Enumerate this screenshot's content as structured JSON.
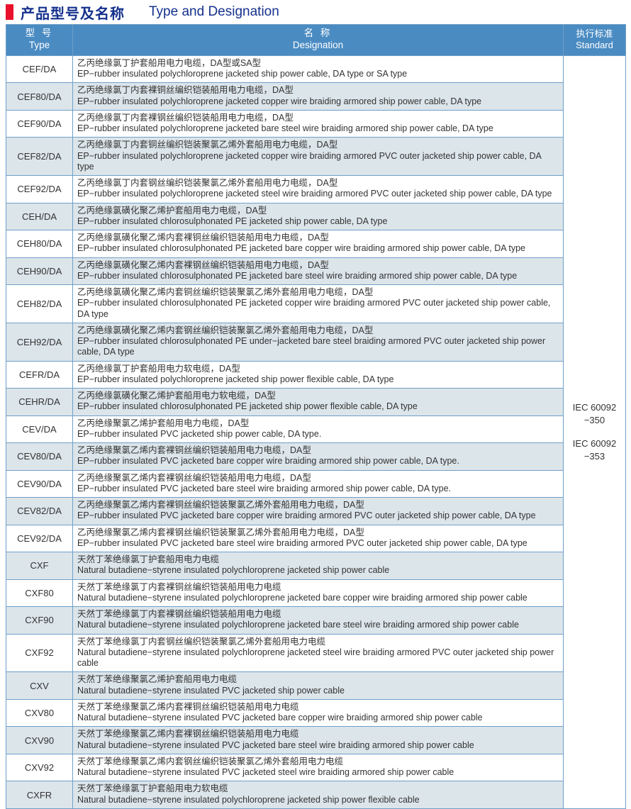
{
  "title": {
    "marker_color": "#e8102a",
    "cn": "产品型号及名称",
    "en": "Type and Designation"
  },
  "colors": {
    "header_blue": "#4a8bc2",
    "border_blue": "#6f9fc8",
    "row_shade": "#dce5ea",
    "title_navy": "#14308c",
    "marker_red": "#e8102a"
  },
  "table": {
    "columns": [
      {
        "cn": "型  号",
        "en": "Type"
      },
      {
        "cn": "名  称",
        "en": "Designation"
      },
      {
        "cn": "执行标准",
        "en": "Standard"
      }
    ],
    "standard": {
      "line1": "IEC 60092",
      "line2": "−350",
      "line3": "IEC 60092",
      "line4": "−353"
    },
    "rows": [
      {
        "type": "CEF/DA",
        "cn": "乙丙绝缘氯丁护套船用电力电缆，DA型或SA型",
        "en": "EP−rubber insulated polychloroprene jacketed ship power cable, DA type or SA type"
      },
      {
        "type": "CEF80/DA",
        "cn": "乙丙绝缘氯丁内套裸铜丝编织铠装船用电力电缆，DA型",
        "en": "EP−rubber insulated polychloroprene jacketed copper wire braiding armored ship power cable, DA type"
      },
      {
        "type": "CEF90/DA",
        "cn": "乙丙绝缘氯丁内套裸钢丝编织铠装船用电力电缆，DA型",
        "en": "EP−rubber insulated polychloroprene jacketed bare steel wire braiding armored ship power cable, DA type"
      },
      {
        "type": "CEF82/DA",
        "cn": "乙丙绝缘氯丁内套铜丝编织铠装聚氯乙烯外套船用电力电缆，DA型",
        "en": "EP−rubber insulated polychloroprene jacketed copper wire braiding armored PVC outer jacketed ship power cable, DA type"
      },
      {
        "type": "CEF92/DA",
        "cn": "乙丙绝缘氯丁内套钢丝编织铠装聚氯乙烯外套船用电力电缆，DA型",
        "en": "EP−rubber insulated polychloroprene jacketed steel wire braiding armored PVC outer jacketed ship power cable, DA type"
      },
      {
        "type": "CEH/DA",
        "cn": "乙丙绝缘氯磺化聚乙烯护套船用电力电缆，DA型",
        "en": "EP−rubber insulated chlorosulphonated PE jacketed ship power cable, DA type"
      },
      {
        "type": "CEH80/DA",
        "cn": "乙丙绝缘氯磺化聚乙烯内套裸铜丝编织铠装船用电力电缆，DA型",
        "en": "EP−rubber insulated chlorosulphonated PE jacketed bare copper wire braiding armored ship power cable, DA type"
      },
      {
        "type": "CEH90/DA",
        "cn": "乙丙绝缘氯磺化聚乙烯内套裸钢丝编织铠装船用电力电缆，DA型",
        "en": "EP−rubber insulated chlorosulphonated PE jacketed bare steel wire braiding armored ship power cable, DA type"
      },
      {
        "type": "CEH82/DA",
        "cn": "乙丙绝缘氯磺化聚乙烯内套铜丝编织铠装聚氯乙烯外套船用电力电缆，DA型",
        "en": "EP−rubber insulated chlorosulphonated PE jacketed copper wire braiding armored PVC outer jacketed ship power cable, DA type"
      },
      {
        "type": "CEH92/DA",
        "cn": "乙丙绝缘氯磺化聚乙烯内套钢丝编织铠装聚氯乙烯外套船用电力电缆，DA型",
        "en": "EP−rubber insulated chlorosulphonated PE under−jacketed bare steel braiding armored PVC outer jacketed ship power cable, DA type"
      },
      {
        "type": "CEFR/DA",
        "cn": "乙丙绝缘氯丁护套船用电力软电缆，DA型",
        "en": "EP−rubber insulated polychloroprene jacketed ship power flexible cable, DA type"
      },
      {
        "type": "CEHR/DA",
        "cn": "乙丙绝缘氯磺化聚乙烯护套船用电力软电缆，DA型",
        "en": "EP−rubber insulated chlorosulphonated PE jacketed ship power flexible cable, DA type"
      },
      {
        "type": "CEV/DA",
        "cn": "乙丙绝缘聚氯乙烯护套船用电力电缆，DA型",
        "en": "EP−rubber insulated PVC jacketed ship power cable, DA type."
      },
      {
        "type": "CEV80/DA",
        "cn": "乙丙绝缘聚氯乙烯内套裸铜丝编织铠装船用电力电缆，DA型",
        "en": "EP−rubber insulated PVC jacketed bare copper wire braiding armored ship power cable, DA type."
      },
      {
        "type": "CEV90/DA",
        "cn": "乙丙绝缘聚氯乙烯内套裸钢丝编织铠装船用电力电缆，DA型",
        "en": "EP−rubber insulated PVC jacketed bare steel wire braiding armored ship power cable, DA type."
      },
      {
        "type": "CEV82/DA",
        "cn": "乙丙绝缘聚氯乙烯内套裸铜丝编织铠装聚氯乙烯外套船用电力电缆，DA型",
        "en": "EP−rubber insulated PVC jacketed bare copper wire braiding armored PVC outer jacketed ship power cable, DA type"
      },
      {
        "type": "CEV92/DA",
        "cn": "乙丙绝缘聚氯乙烯内套裸钢丝编织铠装聚氯乙烯外套船用电力电缆，DA型",
        "en": "EP−rubber insulated PVC jacketed bare steel wire braiding armored PVC outer jacketed ship power cable, DA type"
      },
      {
        "type": "CXF",
        "cn": "天然丁苯绝缘氯丁护套船用电力电缆",
        "en": "Natural butadiene−styrene insulated polychloroprene jacketed ship power cable"
      },
      {
        "type": "CXF80",
        "cn": "天然丁苯绝缘氯丁内套裸铜丝编织铠装船用电力电缆",
        "en": "Natural butadiene−styrene insulated polychloroprene jacketed bare copper wire braiding armored ship power cable"
      },
      {
        "type": "CXF90",
        "cn": "天然丁苯绝缘氯丁内套裸钢丝编织铠装船用电力电缆",
        "en": "Natural butadiene−styrene insulated polychloroprene jacketed bare steel wire braiding armored ship power cable"
      },
      {
        "type": "CXF92",
        "cn": "天然丁苯绝缘氯丁内套钢丝编织铠装聚氯乙烯外套船用电力电缆",
        "en": "Natural butadiene−styrene insulated polychloroprene jacketed steel wire braiding armored PVC outer jacketed ship power cable"
      },
      {
        "type": "CXV",
        "cn": "天然丁苯绝缘聚氯乙烯护套船用电力电缆",
        "en": "Natural butadiene−styrene insulated PVC jacketed ship power cable"
      },
      {
        "type": "CXV80",
        "cn": "天然丁苯绝缘聚氯乙烯内套裸铜丝编织铠装船用电力电缆",
        "en": "Natural butadiene−styrene insulated PVC jacketed bare copper wire braiding armored ship power cable"
      },
      {
        "type": "CXV90",
        "cn": "天然丁苯绝缘聚氯乙烯内套裸钢丝编织铠装船用电力电缆",
        "en": "Natural butadiene−styrene insulated PVC jacketed bare steel wire braiding armored ship power cable"
      },
      {
        "type": "CXV92",
        "cn": "天然丁苯绝缘聚氯乙烯内套钢丝编织铠装聚氯乙烯外套船用电力电缆",
        "en": "Natural butadiene−styrene insulated PVC jacketed steel wire braiding armored ship power cable"
      },
      {
        "type": "CXFR",
        "cn": "天然丁苯绝缘氯丁护套船用电力软电缆",
        "en": "Natural butadiene−styrene insulated polychloroprene jacketed ship power flexible cable"
      }
    ]
  }
}
